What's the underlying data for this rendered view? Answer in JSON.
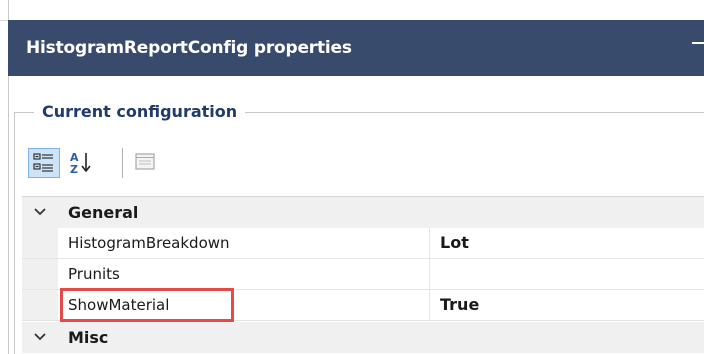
{
  "panel": {
    "title": "HistogramReportConfig properties",
    "minimize_icon": "minimize-icon"
  },
  "group": {
    "label": "Current configuration"
  },
  "toolbar": {
    "categorized_icon": "categorized-view-icon",
    "alphabetical_icon": "sort-alphabetical-icon",
    "property_pages_icon": "property-pages-icon"
  },
  "grid": {
    "categories": [
      {
        "label": "General",
        "expanded": true,
        "properties": [
          {
            "name": "HistogramBreakdown",
            "value": "Lot"
          },
          {
            "name": "Prunits",
            "value": ""
          },
          {
            "name": "ShowMaterial",
            "value": "True"
          }
        ]
      },
      {
        "label": "Misc",
        "expanded": true,
        "properties": []
      }
    ]
  },
  "colors": {
    "header_bg": "#394b6c",
    "group_label": "#1f3a6b",
    "highlight": "#e54a4a",
    "active_button": "#cde3f7"
  }
}
